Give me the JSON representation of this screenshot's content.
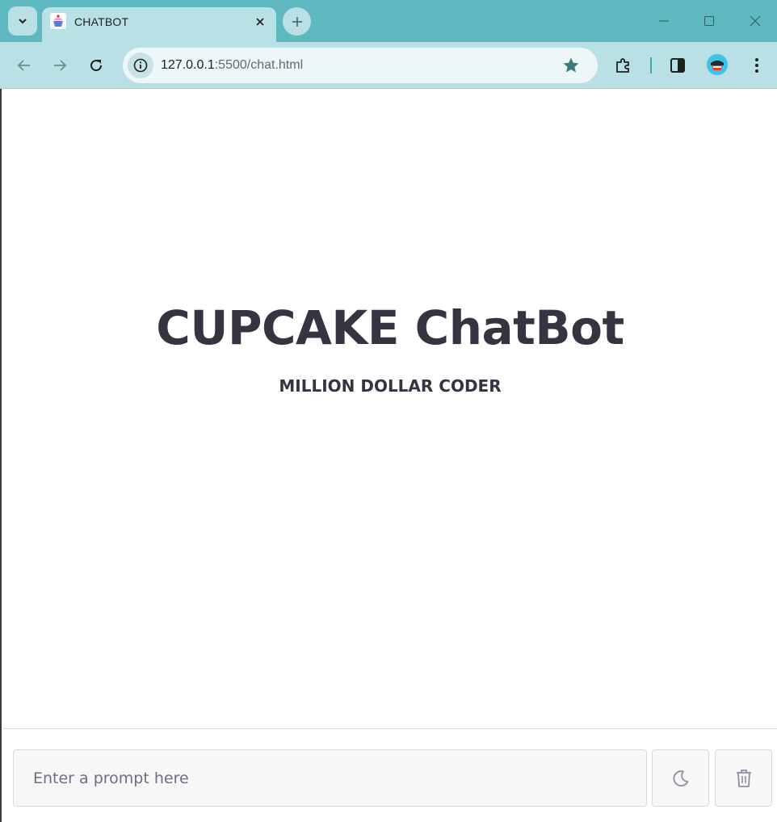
{
  "browser": {
    "tab": {
      "title": "CHATBOT",
      "favicon": "cupcake-icon"
    },
    "address": {
      "host": "127.0.0.1",
      "path": ":5500/chat.html"
    },
    "colors": {
      "frame": "#5eb8c0",
      "toolbar": "#b9e1e5",
      "omnibox": "#eef7f8"
    }
  },
  "page": {
    "title": "CUPCAKE ChatBot",
    "subtitle": "MILLION DOLLAR CODER"
  },
  "footer": {
    "prompt_placeholder": "Enter a prompt here",
    "theme_icon": "moon-icon",
    "delete_icon": "trash-icon"
  },
  "colors": {
    "text": "#343541",
    "input_bg": "#f7f7f8",
    "border": "#d9d9e3"
  }
}
